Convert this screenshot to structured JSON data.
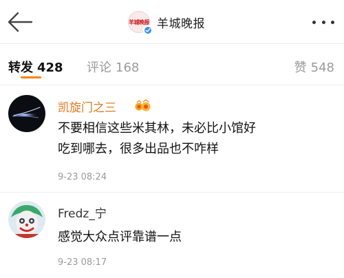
{
  "header": {
    "title": "羊城晚报",
    "logo_text": "羊城晚报"
  },
  "tabs": [
    {
      "label": "转发",
      "count": "428",
      "active": true
    },
    {
      "label": "评论",
      "count": "168",
      "active": false
    },
    {
      "label": "赞",
      "count": "548",
      "active": false
    }
  ],
  "comments": [
    {
      "username": "凯旋门之三",
      "has_vip_badge": true,
      "text_lines": [
        "不要相信这些米其林，未必比小馆好",
        "吃到哪去，很多出品也不咋样"
      ],
      "timestamp": "9-23 08:24"
    },
    {
      "username": "Fredz_宁",
      "has_vip_badge": false,
      "text_lines": [
        "感觉大众点评靠谱一点"
      ],
      "timestamp": "9-23 08:17"
    }
  ],
  "colors": {
    "accent": "#ff8200",
    "vip_username": "#e07a1f",
    "muted": "#9a9a9a",
    "verify_blue": "#3d8ff2",
    "brand_red": "#c8161d"
  },
  "icons": {
    "back": "arrow-left-icon",
    "more": "more-horizontal-icon",
    "verified": "verified-badge-icon",
    "vip": "vip-crown-icon"
  }
}
